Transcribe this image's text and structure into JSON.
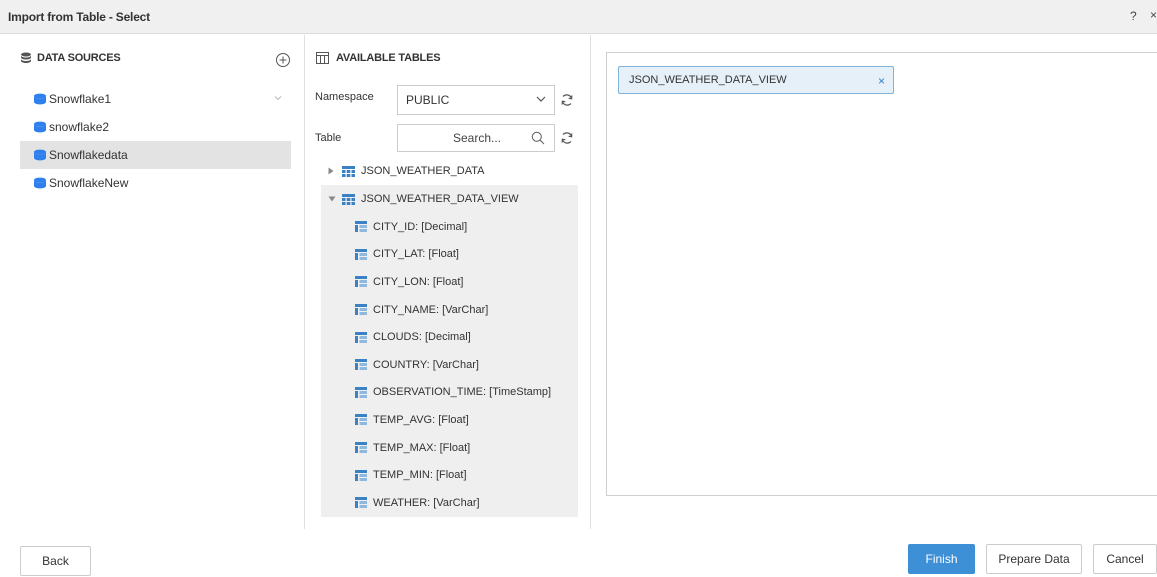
{
  "window": {
    "title": "Import from Table - Select",
    "help_glyph": "?",
    "close_glyph": "×"
  },
  "data_sources": {
    "header": "DATA SOURCES",
    "items": [
      {
        "label": "Snowflake1"
      },
      {
        "label": "snowflake2"
      },
      {
        "label": "Snowflakedata",
        "selected": true
      },
      {
        "label": "SnowflakeNew"
      }
    ]
  },
  "available_tables": {
    "header": "AVAILABLE TABLES",
    "namespace_label": "Namespace",
    "namespace_value": "PUBLIC",
    "table_label": "Table",
    "search_placeholder": "Search...",
    "tables": [
      {
        "name": "JSON_WEATHER_DATA",
        "expanded": false
      },
      {
        "name": "JSON_WEATHER_DATA_VIEW",
        "expanded": true
      }
    ],
    "columns": [
      "CITY_ID: [Decimal]",
      "CITY_LAT: [Float]",
      "CITY_LON: [Float]",
      "CITY_NAME: [VarChar]",
      "CLOUDS: [Decimal]",
      "COUNTRY: [VarChar]",
      "OBSERVATION_TIME: [TimeStamp]",
      "TEMP_AVG: [Float]",
      "TEMP_MAX: [Float]",
      "TEMP_MIN: [Float]",
      "WEATHER: [VarChar]"
    ]
  },
  "selected_tables": {
    "chips": [
      {
        "label": "JSON_WEATHER_DATA_VIEW",
        "remove_glyph": "×"
      }
    ]
  },
  "footer": {
    "back_label": "Back",
    "finish_label": "Finish",
    "prepare_label": "Prepare Data",
    "cancel_label": "Cancel"
  },
  "colors": {
    "primary": "#3d8fd6",
    "database_icon": "#2f80ed",
    "table_icon": "#3b82c4",
    "chip_bg": "#e6f0f8",
    "chip_border": "#7fb3d9",
    "selected_row": "#e3e3e3"
  },
  "icons": {
    "data_sources_header": "database-stack-icon",
    "add_source": "plus-circle-icon",
    "source_item": "database-icon",
    "available_tables_header": "table-grid-icon",
    "namespace_dropdown": "chevron-down-icon",
    "refresh": "refresh-icon",
    "search": "search-icon",
    "table": "table-icon",
    "expand": "triangle-right-icon",
    "collapse": "triangle-down-icon"
  }
}
